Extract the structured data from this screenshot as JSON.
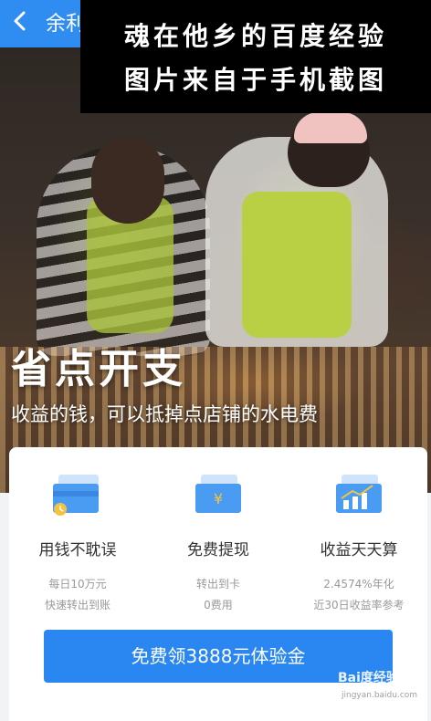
{
  "appbar": {
    "title": "余利"
  },
  "watermark": {
    "line1": "魂在他乡的百度经验",
    "line2": "图片来自于手机截图"
  },
  "hero": {
    "title": "省点开支",
    "subtitle": "收益的钱，可以抵掉点店铺的水电费"
  },
  "features": [
    {
      "icon": "card-icon",
      "title": "用钱不耽误",
      "line1": "每日10万元",
      "line2": "快速转出到账"
    },
    {
      "icon": "yen-card-icon",
      "title": "免费提现",
      "line1": "转出到卡",
      "line2": "0费用"
    },
    {
      "icon": "chart-icon",
      "title": "收益天天算",
      "line1": "2.4574%年化",
      "line2": "近30日收益率参考"
    }
  ],
  "cta": {
    "label": "免费领3888元体验金"
  },
  "logo": {
    "brand": "Bai度经验",
    "url": "jingyan.baidu.com"
  },
  "colors": {
    "primary": "#2f8cf0",
    "cta": "#2a86f0",
    "icon_blue": "#4a9bf2",
    "icon_light": "#cfe4fb"
  }
}
